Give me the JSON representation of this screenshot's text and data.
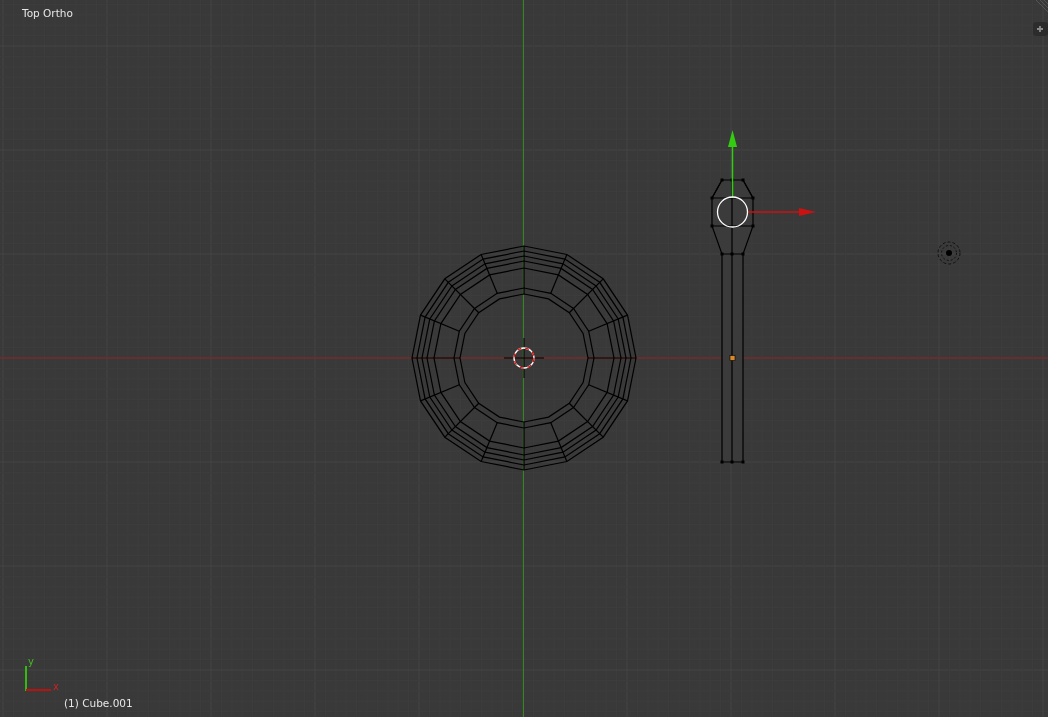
{
  "viewport": {
    "view_name": "Top Ortho",
    "axis_gizmo": {
      "y_label": "y",
      "x_label": "x"
    },
    "object_info": "(1) Cube.001"
  }
}
